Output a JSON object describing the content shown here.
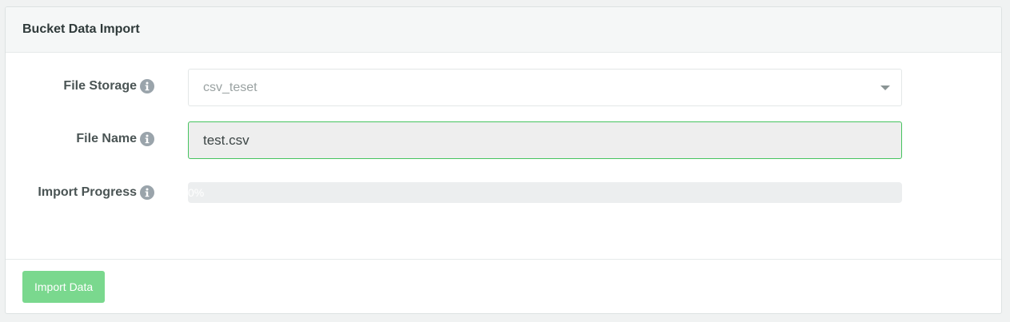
{
  "panel": {
    "title": "Bucket Data Import"
  },
  "form": {
    "file_storage": {
      "label": "File Storage",
      "icon": "info-icon",
      "selected": "csv_teset"
    },
    "file_name": {
      "label": "File Name",
      "icon": "info-icon",
      "value": "test.csv"
    },
    "import_progress": {
      "label": "Import Progress",
      "icon": "info-icon",
      "percent": 0,
      "text": "0%"
    }
  },
  "footer": {
    "import_button_label": "Import Data"
  },
  "colors": {
    "accent": "#46c35f",
    "button_disabled": "#7ad88e",
    "info_icon": "#9aa4ab"
  }
}
